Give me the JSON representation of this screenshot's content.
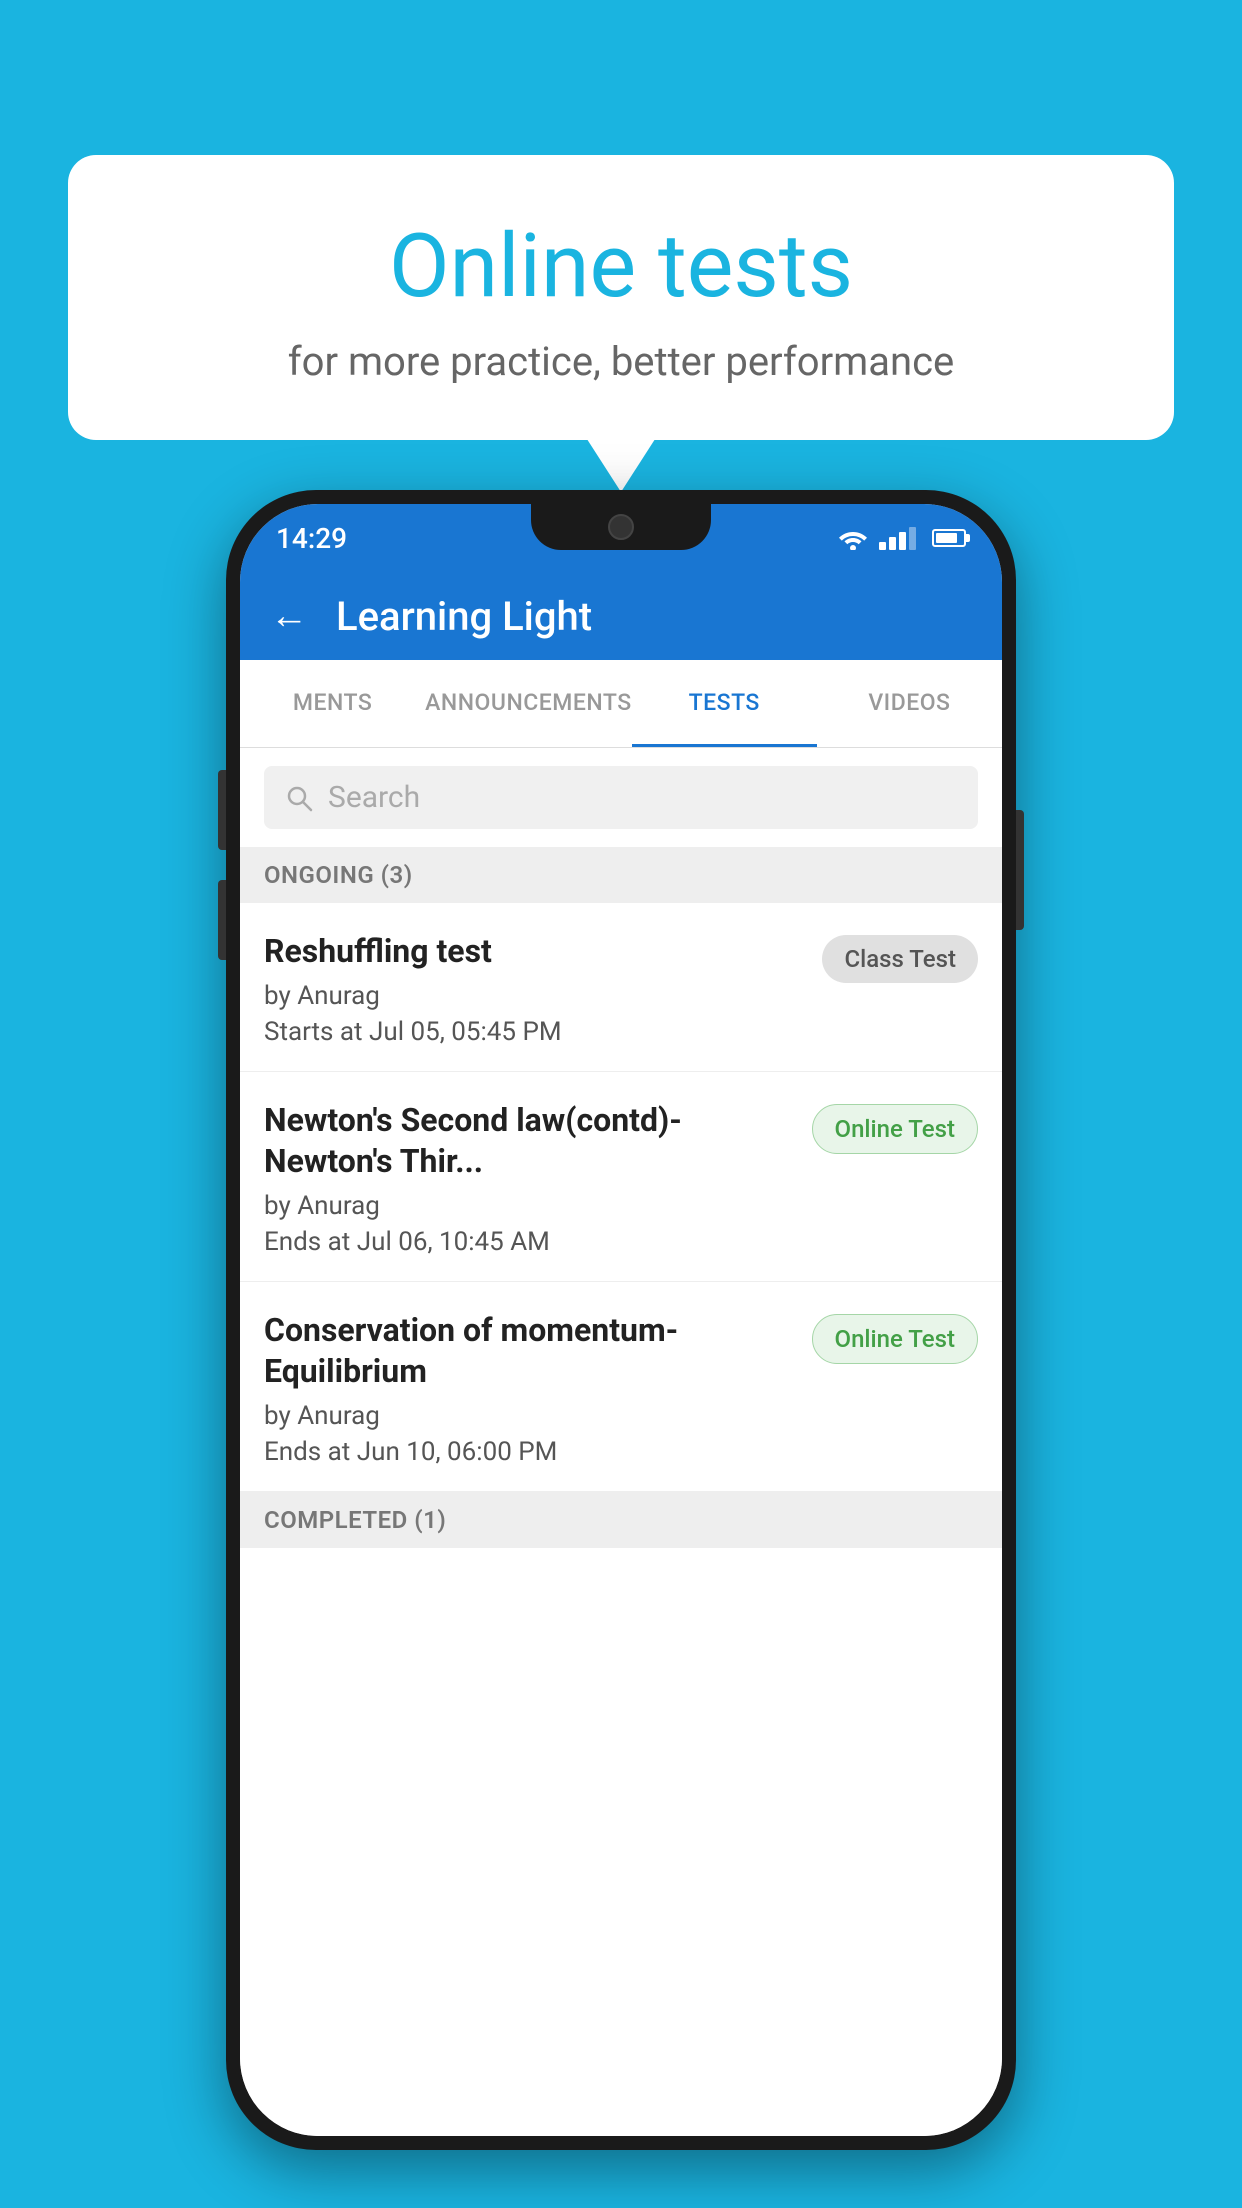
{
  "background": {
    "color": "#1ab4e0"
  },
  "speech_bubble": {
    "title": "Online tests",
    "subtitle": "for more practice, better performance"
  },
  "phone": {
    "status_bar": {
      "time": "14:29"
    },
    "header": {
      "title": "Learning Light",
      "back_label": "←"
    },
    "tabs": [
      {
        "label": "MENTS",
        "active": false
      },
      {
        "label": "ANNOUNCEMENTS",
        "active": false
      },
      {
        "label": "TESTS",
        "active": true
      },
      {
        "label": "VIDEOS",
        "active": false
      }
    ],
    "search": {
      "placeholder": "Search"
    },
    "ongoing_section": {
      "label": "ONGOING (3)"
    },
    "test_items": [
      {
        "title": "Reshuffling test",
        "author": "by Anurag",
        "time_label": "Starts at",
        "time_value": "Jul 05, 05:45 PM",
        "badge": "Class Test",
        "badge_type": "class"
      },
      {
        "title": "Newton's Second law(contd)-Newton's Thir...",
        "author": "by Anurag",
        "time_label": "Ends at",
        "time_value": "Jul 06, 10:45 AM",
        "badge": "Online Test",
        "badge_type": "online"
      },
      {
        "title": "Conservation of momentum-Equilibrium",
        "author": "by Anurag",
        "time_label": "Ends at",
        "time_value": "Jun 10, 06:00 PM",
        "badge": "Online Test",
        "badge_type": "online"
      }
    ],
    "completed_section": {
      "label": "COMPLETED (1)"
    }
  }
}
